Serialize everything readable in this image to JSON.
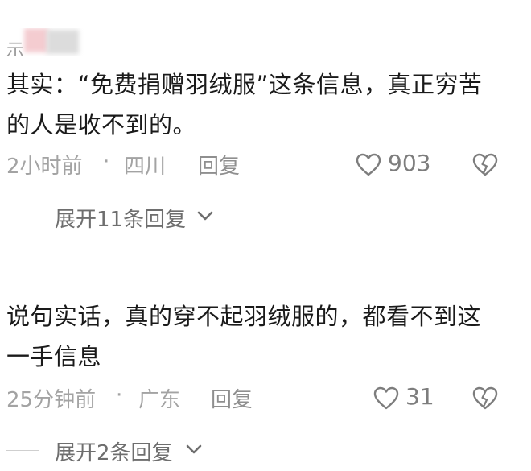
{
  "comments": [
    {
      "username": "示",
      "text": "其实：“免费捐赠羽绒服”这条信息，真正穷苦的人是收不到的。",
      "time": "2小时前",
      "separator": "·",
      "location": "四川",
      "reply_label": "回复",
      "likes": "903",
      "expand_label": "展开11条回复"
    },
    {
      "username": "",
      "text": "说句实话，真的穿不起羽绒服的，都看不到这一手信息",
      "time": "25分钟前",
      "separator": "·",
      "location": "广东",
      "reply_label": "回复",
      "likes": "31",
      "expand_label": "展开2条回复"
    }
  ],
  "icons": {
    "like": "heart-outline-icon",
    "dislike": "broken-heart-icon",
    "expand": "chevron-down-icon"
  },
  "colors": {
    "text_primary": "#1a1a1a",
    "meta_gray": "#a3a3a3",
    "icon_gray": "#7d7d7d"
  }
}
